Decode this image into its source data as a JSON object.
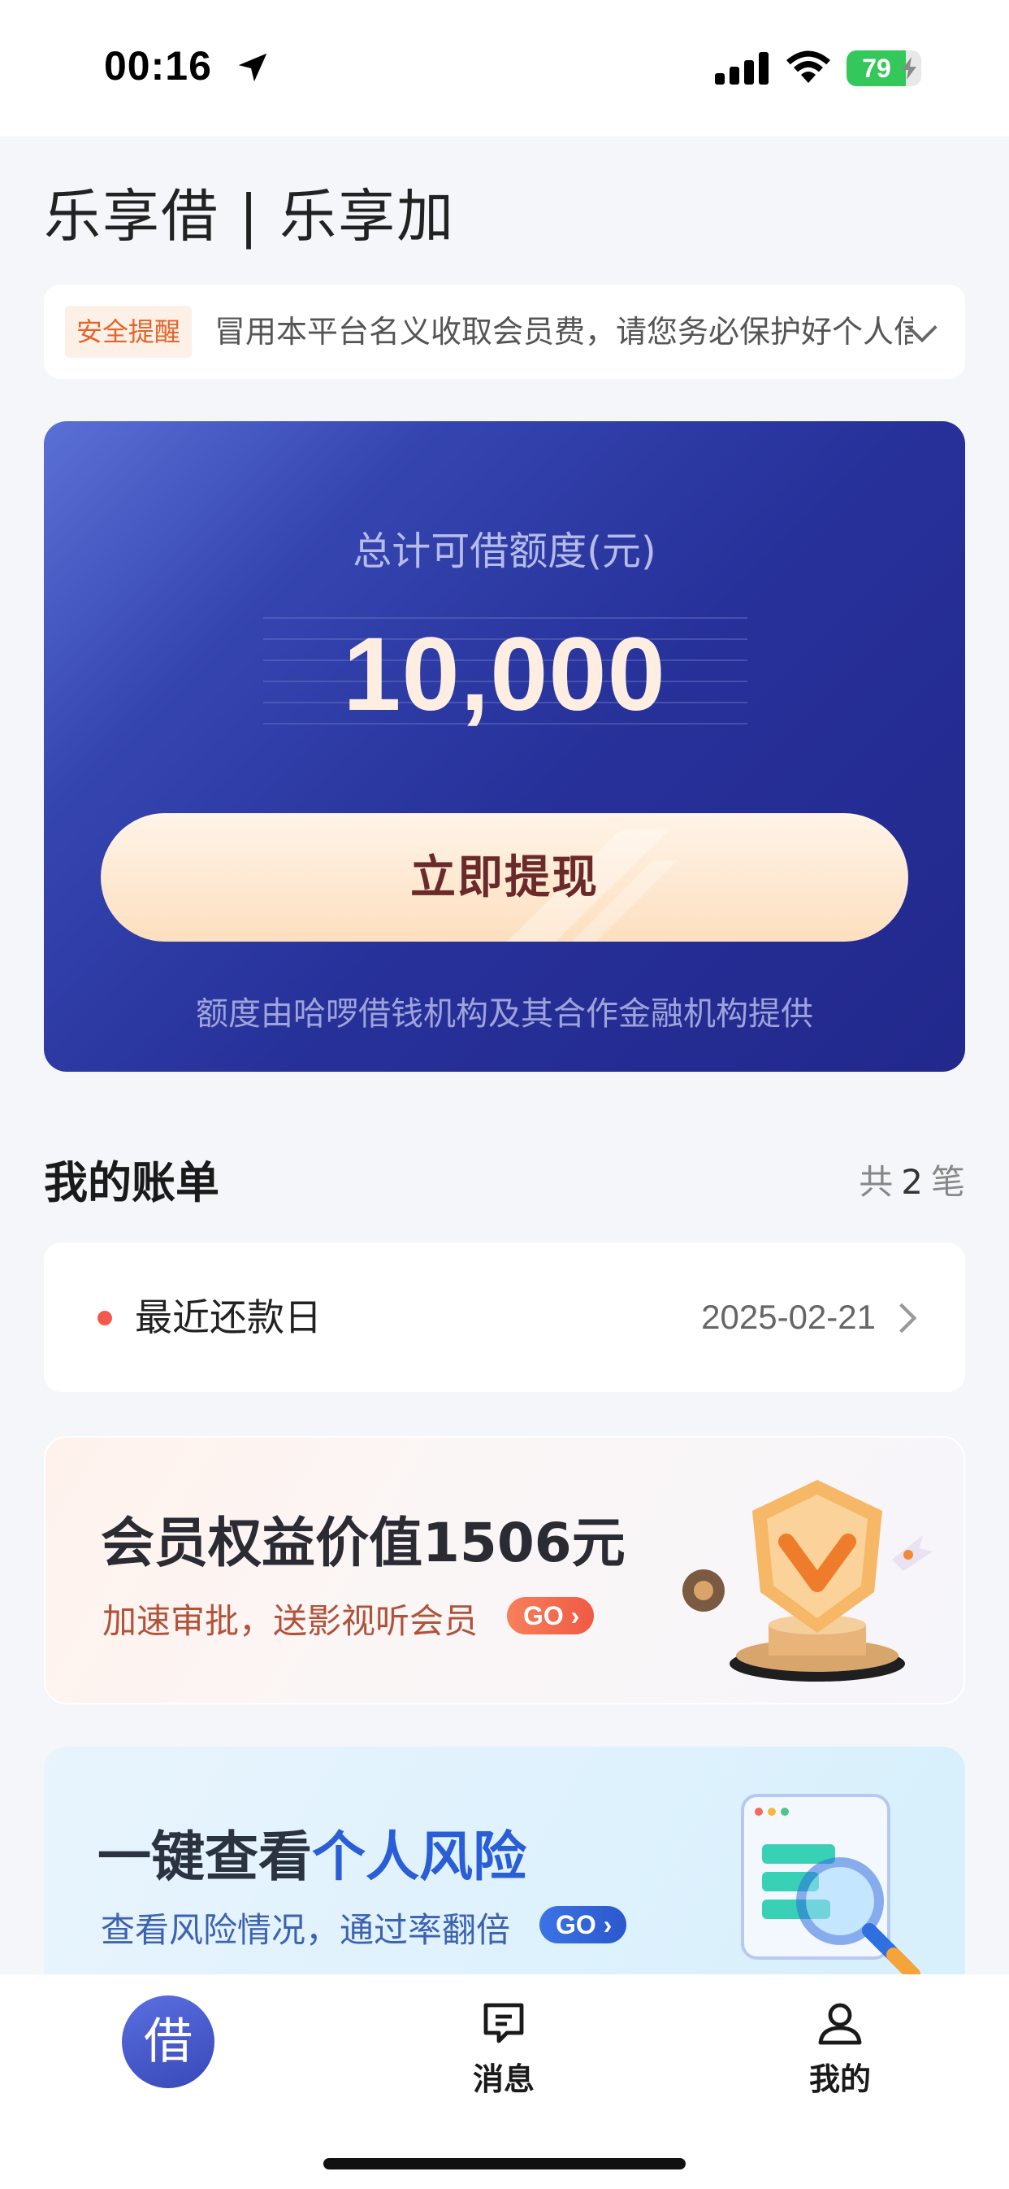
{
  "status_bar": {
    "time": "00:16",
    "battery": "79",
    "battery_level": 0.79
  },
  "header": {
    "title": "乐享借 | 乐享加"
  },
  "notice": {
    "tag": "安全提醒",
    "text": "冒用本平台名义收取会员费，请您务必保护好个人信息",
    "icon": "chevron-down-icon"
  },
  "credit": {
    "label": "总计可借额度(元)",
    "amount": "10,000",
    "button_label": "立即提现",
    "footnote": "额度由哈啰借钱机构及其合作金融机构提供"
  },
  "bills": {
    "title": "我的账单",
    "count_prefix": "共",
    "count": "2",
    "count_suffix": "笔",
    "row_label": "最近还款日",
    "row_date": "2025-02-21"
  },
  "member_promo": {
    "title": "会员权益价值1506元",
    "subtitle": "加速审批，送影视听会员",
    "go": "GO"
  },
  "risk_promo": {
    "title_part1": "一键查看",
    "title_part2": "个人风险",
    "subtitle": "查看风险情况，通过率翻倍",
    "go": "GO"
  },
  "tab_bar": {
    "home": "借",
    "messages": "消息",
    "mine": "我的"
  },
  "colors": {
    "card_gradient_start": "#5b70d6",
    "card_gradient_end": "#22288c",
    "button_text": "#6b2a2a",
    "notice_tag": "#e3642a",
    "accent_blue": "#2a5ed6"
  }
}
